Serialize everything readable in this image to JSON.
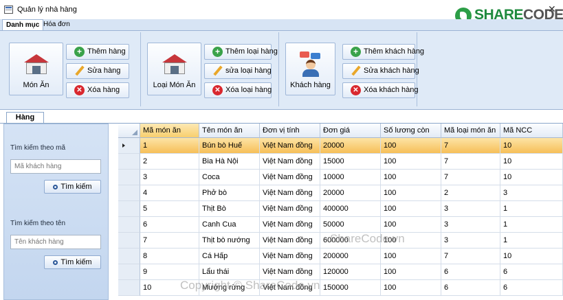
{
  "window": {
    "title": "Quản lý nhà hàng",
    "logo_text_a": "SHARE",
    "logo_text_b": "CODE.vn",
    "close_glyph": "✕"
  },
  "tabs": [
    {
      "label": "Danh mục",
      "active": true
    },
    {
      "label": "Hóa đơn",
      "active": false
    }
  ],
  "ribbon": {
    "groups": [
      {
        "big_label": "Món Ăn",
        "icon": "store-icon",
        "buttons": [
          "Thêm hàng",
          "Sửa hàng",
          "Xóa hàng"
        ]
      },
      {
        "big_label": "Loại Món Ăn",
        "icon": "store-icon",
        "buttons": [
          "Thêm loại hàng",
          "sửa loại hàng",
          "Xóa loại hàng"
        ]
      },
      {
        "big_label": "Khách hàng",
        "icon": "customers-icon",
        "buttons": [
          "Thêm khách hàng",
          "Sửa khách hàng",
          "Xóa khách hàng"
        ]
      }
    ]
  },
  "panel": {
    "tab_label": "Hàng"
  },
  "search": {
    "by_code_label": "Tìm kiếm theo mã",
    "by_code_placeholder": "Mã khách hàng",
    "by_name_label": "Tìm kiếm theo tên",
    "by_name_placeholder": "Tên khách hàng",
    "button_label": "Tìm kiếm"
  },
  "table": {
    "columns": [
      "Mã món ăn",
      "Tên món ăn",
      "Đơn vị tính",
      "Đơn giá",
      "Số lương còn",
      "Mã loại món ăn",
      "Mã NCC"
    ],
    "selected_row": 0,
    "rows": [
      [
        "1",
        "Bún bò Huế",
        "Việt Nam đồng",
        "20000",
        "100",
        "7",
        "10"
      ],
      [
        "2",
        "Bia Hà Nội",
        "Việt Nam đồng",
        "15000",
        "100",
        "7",
        "10"
      ],
      [
        "3",
        "Coca",
        "Việt Nam đồng",
        "10000",
        "100",
        "7",
        "10"
      ],
      [
        "4",
        "Phở bò",
        "Việt Nam đồng",
        "20000",
        "100",
        "2",
        "3"
      ],
      [
        "5",
        "Thịt Bò",
        "Việt Nam đồng",
        "400000",
        "100",
        "3",
        "1"
      ],
      [
        "6",
        "Canh Cua",
        "Việt Nam đồng",
        "50000",
        "100",
        "3",
        "1"
      ],
      [
        "7",
        "Thịt bò nướng",
        "Việt Nam đồng",
        "600000",
        "100",
        "3",
        "1"
      ],
      [
        "8",
        "Cá Hấp",
        "Việt Nam đồng",
        "200000",
        "100",
        "7",
        "10"
      ],
      [
        "9",
        "Lẩu thái",
        "Việt Nam đồng",
        "120000",
        "100",
        "6",
        "6"
      ],
      [
        "10",
        "Mướng rừng",
        "Việt Nam đồng",
        "150000",
        "100",
        "6",
        "6"
      ]
    ]
  },
  "watermarks": [
    "ShareCode.vn",
    "Copyright © ShareCode.vn"
  ]
}
